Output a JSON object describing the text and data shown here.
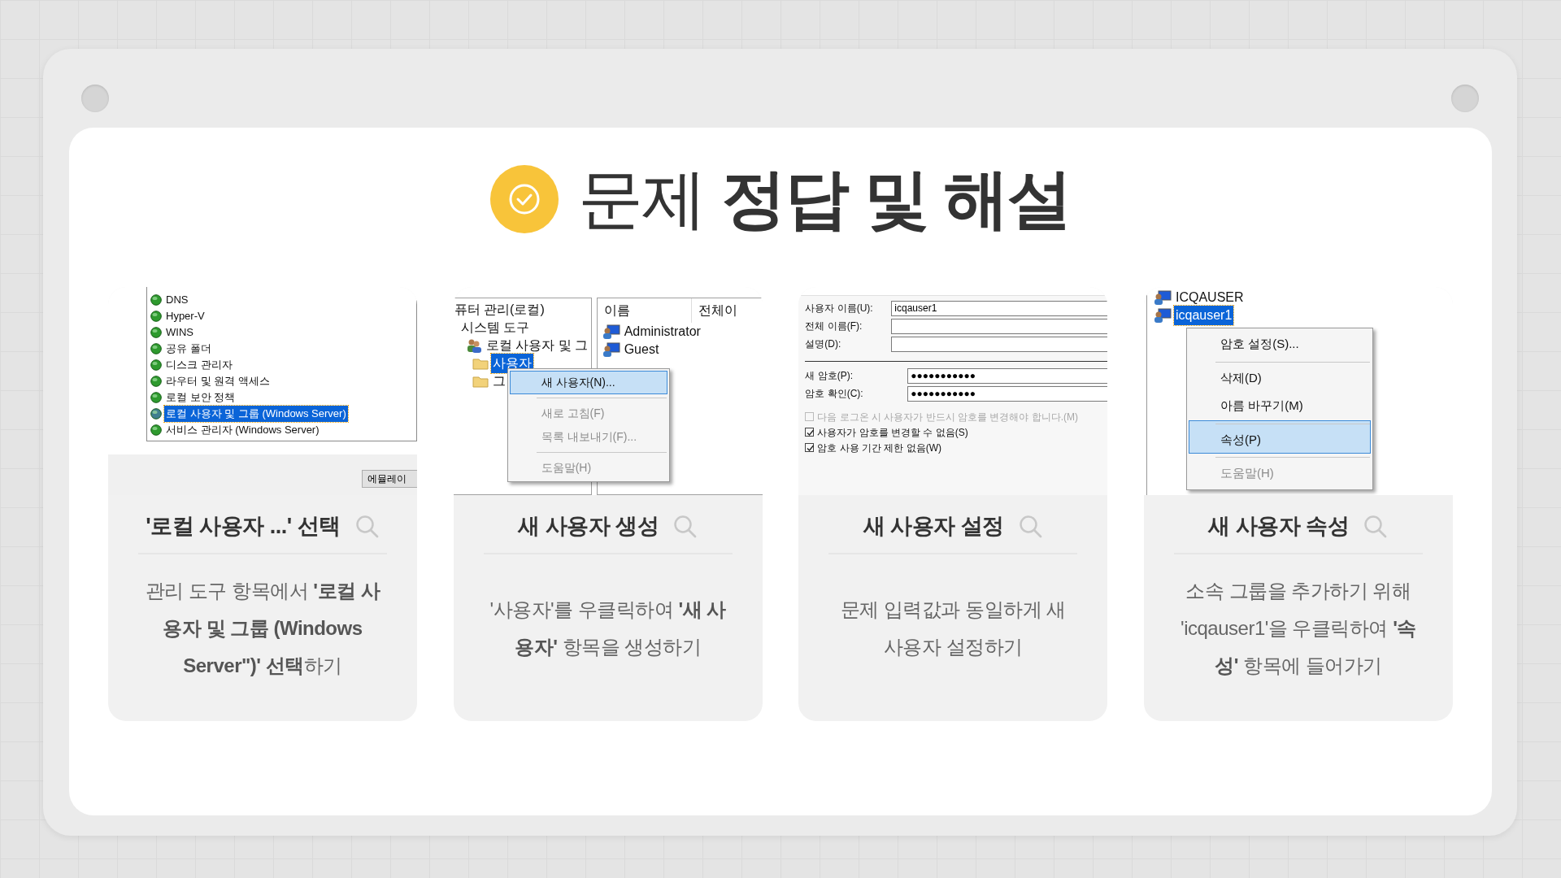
{
  "title": "문제 **정답 및 해설**",
  "cards": [
    {
      "heading": "'로컬 사용자 ...' 선택",
      "description": "관리 도구 항목에서 **'로컬 사용자 및 그룹 (Windows Server\")' 선택**하기",
      "shot": {
        "kind": "service-list",
        "tree": [
          {
            "label": "DNS",
            "kind": "service",
            "selected": false
          },
          {
            "label": "Hyper-V",
            "kind": "service",
            "selected": false
          },
          {
            "label": "WINS",
            "kind": "service",
            "selected": false
          },
          {
            "label": "공유 폴더",
            "kind": "service",
            "selected": false
          },
          {
            "label": "디스크 관리자",
            "kind": "service",
            "selected": false
          },
          {
            "label": "라우터 및 원격 액세스",
            "kind": "service",
            "selected": false
          },
          {
            "label": "로컬 보안 정책",
            "kind": "service",
            "selected": false
          },
          {
            "label": "로컬 사용자 및 그룹 (Windows Server)",
            "kind": "service",
            "selected": true
          },
          {
            "label": "서비스 관리자 (Windows Server)",
            "kind": "service",
            "selected": false
          }
        ],
        "button": "에뮬레이"
      }
    },
    {
      "heading": "새 사용자 생성",
      "description": "'사용자'를 우클릭하여 **'새 사용자'** 항목을 생성하기",
      "shot": {
        "kind": "split-menu",
        "tree": [
          {
            "label": "퓨터 관리(로컬)",
            "selected": false,
            "children": [
              {
                "label": "시스템 도구",
                "selected": false,
                "children": [
                  {
                    "label": "로컬 사용자 및 그",
                    "kind": "group",
                    "selected": false,
                    "children": [
                      {
                        "label": "사용자",
                        "kind": "folder",
                        "selected": true
                      },
                      {
                        "label": "그",
                        "kind": "folder",
                        "selected": false
                      }
                    ]
                  }
                ]
              }
            ]
          }
        ],
        "list": {
          "columns": [
            "이름",
            "전체이"
          ],
          "rows": [
            "Administrator",
            "Guest"
          ]
        },
        "menu": [
          {
            "label": "새 사용자(N)...",
            "selected": true,
            "disabled": false,
            "separator_before": false
          },
          {
            "label": "새로 고침(F)",
            "selected": false,
            "disabled": true,
            "separator_before": true
          },
          {
            "label": "목록 내보내기(F)...",
            "selected": false,
            "disabled": true,
            "separator_before": false
          },
          {
            "label": "도움말(H)",
            "selected": false,
            "disabled": true,
            "separator_before": true
          }
        ]
      }
    },
    {
      "heading": "새 사용자 설정",
      "description": "문제 입력값과 동일하게 새 사용자 설정하기",
      "shot": {
        "kind": "form",
        "fields": [
          {
            "label": "사용자 이름(U):",
            "kind": "text",
            "value": "icqauser1"
          },
          {
            "label": "전체 이름(F):",
            "kind": "text"
          },
          {
            "label": "설명(D):",
            "kind": "text"
          },
          {
            "label": "새 암호(P):",
            "kind": "password",
            "value": "●●●●●●●●●●●"
          },
          {
            "label": "암호 확인(C):",
            "kind": "password",
            "value": "●●●●●●●●●●●"
          }
        ],
        "checks": [
          {
            "label": "다음 로그온 시 사용자가 반드시 암호를 변경해야 합니다.(M)",
            "checked": false,
            "disabled": true
          },
          {
            "label": "사용자가 암호를 변경할 수 없음(S)",
            "checked": true,
            "disabled": false
          },
          {
            "label": "암호 사용 기간 제한 없음(W)",
            "checked": true,
            "disabled": false
          }
        ]
      }
    },
    {
      "heading": "새 사용자 속성",
      "description": "소속 그룹을 추가하기 위해 'icqauser1'을 우클릭하여 **'속성'** 항목에 들어가기",
      "shot": {
        "kind": "user-menu",
        "tree": [
          {
            "label": "ICQAUSER",
            "kind": "user",
            "selected": false
          },
          {
            "label": "icqauser1",
            "kind": "user",
            "selected": true
          }
        ],
        "menu": [
          {
            "label": "암호 설정(S)...",
            "selected": false,
            "disabled": false,
            "separator_before": false
          },
          {
            "label": "삭제(D)",
            "selected": false,
            "disabled": false,
            "separator_before": true
          },
          {
            "label": "아름 바꾸기(M)",
            "selected": false,
            "disabled": false,
            "separator_before": false
          },
          {
            "label": "속성(P)",
            "selected": true,
            "disabled": false,
            "separator_before": true
          },
          {
            "label": "도움말(H)",
            "selected": false,
            "disabled": true,
            "separator_before": true
          }
        ]
      }
    }
  ]
}
